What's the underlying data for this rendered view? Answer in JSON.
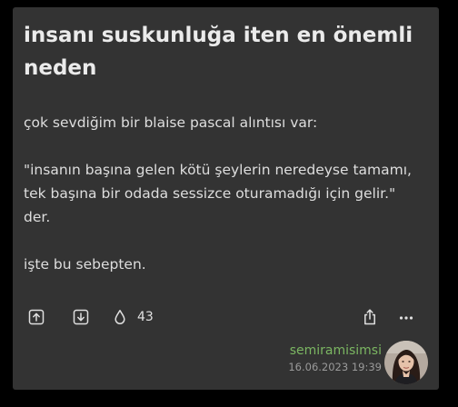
{
  "entry": {
    "title_line1": "insanı suskunluğa iten en önemli",
    "title_line2": "neden",
    "paragraphs": {
      "intro": "çok sevdiğim bir blaise pascal alıntısı var:",
      "quote_line1": "\"insanın başına gelen kötü şeylerin neredeyse tamamı,",
      "quote_line2": "tek başına bir odada sessizce oturamadığı için gelir.\"",
      "quote_line3": "der.",
      "outro": "işte bu sebepten."
    }
  },
  "actions": {
    "upvote_icon": "arrow-up-box-icon",
    "downvote_icon": "arrow-down-box-icon",
    "drop_icon": "drop-icon",
    "drop_count": "43",
    "share_icon": "share-icon",
    "more_icon": "more-dots-icon"
  },
  "author": {
    "name": "semiramisimsi",
    "date": "16.06.2023 19:39"
  },
  "colors": {
    "page_background": "#000000",
    "card_background": "#333333",
    "author_green": "#7bb662"
  }
}
